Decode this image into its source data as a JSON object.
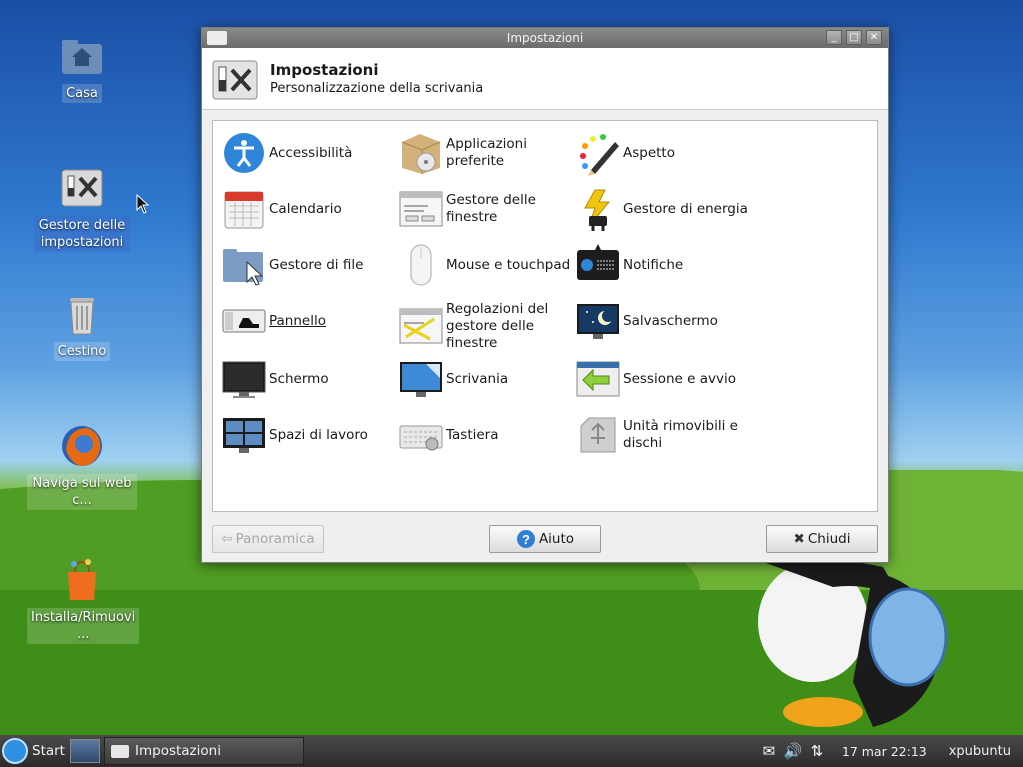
{
  "desktop": {
    "icons": [
      {
        "label": "Casa"
      },
      {
        "label": "Gestore delle impostazioni"
      },
      {
        "label": "Cestino"
      },
      {
        "label": "Naviga sul web c..."
      },
      {
        "label": "Installa/Rimuovi ..."
      }
    ]
  },
  "window": {
    "title": "Impostazioni",
    "header_title": "Impostazioni",
    "header_subtitle": "Personalizzazione della scrivania",
    "items": [
      {
        "label": "Accessibilità",
        "icon": "accessibility-icon"
      },
      {
        "label": "Applicazioni preferite",
        "icon": "preferred-apps-icon"
      },
      {
        "label": "Aspetto",
        "icon": "appearance-icon"
      },
      {
        "label": "Calendario",
        "icon": "calendar-icon"
      },
      {
        "label": "Gestore delle finestre",
        "icon": "window-manager-icon"
      },
      {
        "label": "Gestore di energia",
        "icon": "power-manager-icon"
      },
      {
        "label": "Gestore di file",
        "icon": "file-manager-icon"
      },
      {
        "label": "Mouse e touchpad",
        "icon": "mouse-icon"
      },
      {
        "label": "Notifiche",
        "icon": "notifications-icon"
      },
      {
        "label": "Pannello",
        "icon": "panel-icon"
      },
      {
        "label": "Regolazioni del gestore delle finestre",
        "icon": "wm-tweaks-icon"
      },
      {
        "label": "Salvaschermo",
        "icon": "screensaver-icon"
      },
      {
        "label": "Schermo",
        "icon": "display-icon"
      },
      {
        "label": "Scrivania",
        "icon": "desktop-icon"
      },
      {
        "label": "Sessione e avvio",
        "icon": "session-icon"
      },
      {
        "label": "Spazi di lavoro",
        "icon": "workspaces-icon"
      },
      {
        "label": "Tastiera",
        "icon": "keyboard-icon"
      },
      {
        "label": "Unità rimovibili e dischi",
        "icon": "removable-drives-icon"
      }
    ],
    "buttons": {
      "overview": "Panoramica",
      "help": "Aiuto",
      "close": "Chiudi"
    }
  },
  "taskbar": {
    "start": "Start",
    "task": "Impostazioni",
    "clock": "17 mar  22:13",
    "user": "xpubuntu"
  }
}
